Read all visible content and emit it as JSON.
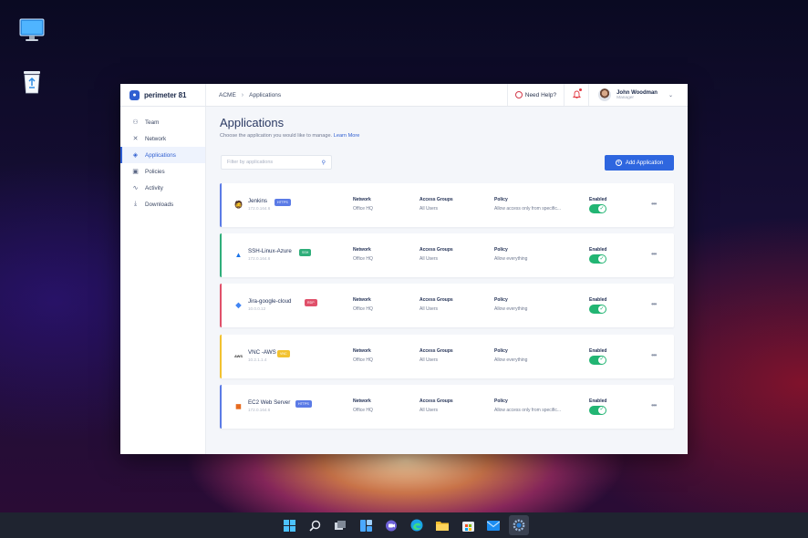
{
  "desktop": {
    "icons": [
      "monitor-icon",
      "recycle-bin-icon"
    ]
  },
  "topbar": {
    "brand": "perimeter 81",
    "breadcrumb": [
      "ACME",
      "Applications"
    ],
    "help_label": "Need Help?",
    "user_name": "John Woodman",
    "user_role": "Manager"
  },
  "sidebar": {
    "items": [
      {
        "label": "Team",
        "icon": "team-icon"
      },
      {
        "label": "Network",
        "icon": "network-icon"
      },
      {
        "label": "Applications",
        "icon": "applications-icon",
        "active": true
      },
      {
        "label": "Policies",
        "icon": "policies-icon"
      },
      {
        "label": "Activity",
        "icon": "activity-icon"
      },
      {
        "label": "Downloads",
        "icon": "downloads-icon"
      }
    ]
  },
  "main": {
    "title": "Applications",
    "subtitle": "Choose the application you would like to manage.",
    "learn_more": "Learn More",
    "filter_placeholder": "Filter by applications",
    "add_button": "Add Application",
    "column_headers": {
      "network": "Network",
      "access": "Access Groups",
      "policy": "Policy",
      "enabled": "Enabled"
    },
    "apps": [
      {
        "name": "Jenkins",
        "ip": "172.0.164.6",
        "badge": "HTTPS",
        "badge_color": "#5b7be6",
        "accent": "#5b7be6",
        "network": "Office HQ",
        "access": "All Users",
        "policy": "Allow access only from specific...",
        "enabled": true
      },
      {
        "name": "SSH-Linux-Azure",
        "ip": "172.0.164.6",
        "badge": "SSH",
        "badge_color": "#2fae7a",
        "accent": "#2fae7a",
        "network": "Office HQ",
        "access": "All Users",
        "policy": "Allow everything",
        "enabled": true
      },
      {
        "name": "Jira-google-cloud",
        "ip": "10.0.0.12",
        "badge": "RDP",
        "badge_color": "#e0506a",
        "accent": "#e0506a",
        "network": "Office HQ",
        "access": "All Users",
        "policy": "Allow everything",
        "enabled": true
      },
      {
        "name": "VNC -AWS",
        "ip": "10.2.1.1.4",
        "badge": "VNC",
        "badge_color": "#f2c230",
        "accent": "#f2c230",
        "network": "Office HQ",
        "access": "All Users",
        "policy": "Allow everything",
        "enabled": true
      },
      {
        "name": "EC2 Web Server",
        "ip": "172.0.164.6",
        "badge": "HTTPS",
        "badge_color": "#5b7be6",
        "accent": "#5b7be6",
        "network": "Office HQ",
        "access": "All Users",
        "policy": "Allow access only from specific...",
        "enabled": true
      }
    ]
  },
  "taskbar": {
    "icons": [
      "start-icon",
      "search-icon",
      "task-view-icon",
      "widgets-icon",
      "teams-chat-icon",
      "edge-icon",
      "file-explorer-icon",
      "store-icon",
      "mail-icon",
      "settings-icon"
    ]
  }
}
